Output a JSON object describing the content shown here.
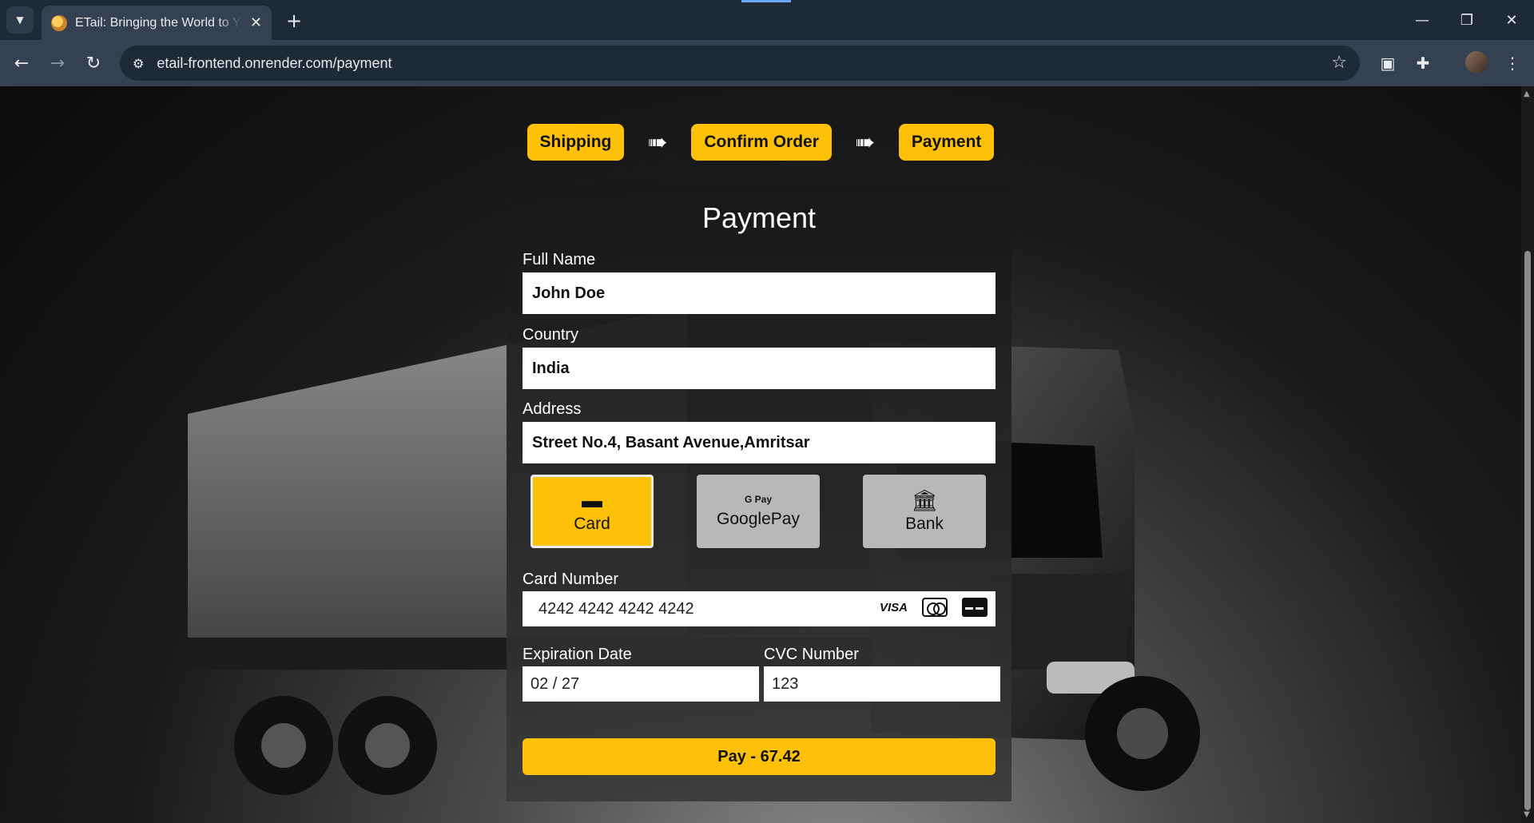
{
  "browser": {
    "tab_title": "ETail: Bringing the World to Your Door",
    "url": "etail-frontend.onrender.com/payment"
  },
  "steps": [
    "Shipping",
    "Confirm Order",
    "Payment"
  ],
  "form": {
    "title": "Payment",
    "full_name_label": "Full Name",
    "full_name_value": "John Doe",
    "country_label": "Country",
    "country_value": "India",
    "address_label": "Address",
    "address_value": "Street No.4, Basant Avenue,Amritsar",
    "methods": [
      {
        "label": "Card",
        "icon": "card-icon",
        "selected": true
      },
      {
        "label": "GooglePay",
        "icon_text": "G Pay",
        "icon": "gpay-icon",
        "selected": false
      },
      {
        "label": "Bank",
        "icon": "bank-icon",
        "selected": false
      }
    ],
    "card_number_label": "Card Number",
    "card_number_value": "4242 4242 4242 4242",
    "card_brands": {
      "visa": "VISA"
    },
    "expiry_label": "Expiration Date",
    "expiry_value": "02 / 27",
    "cvc_label": "CVC Number",
    "cvc_value": "123",
    "pay_button": "Pay - 67.42"
  },
  "colors": {
    "accent": "#ffc107",
    "chrome_bg": "#1f2a37",
    "toolbar_bg": "#354150"
  }
}
